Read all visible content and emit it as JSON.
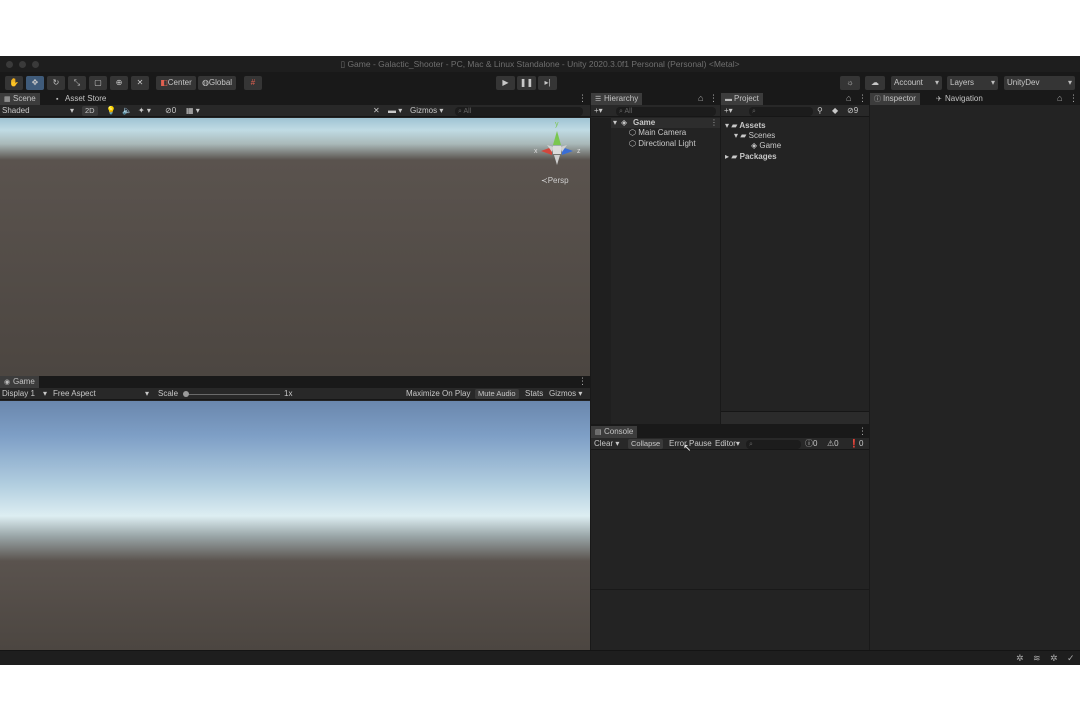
{
  "window": {
    "title": "Game - Galactic_Shooter - PC, Mac & Linux Standalone - Unity 2020.3.0f1 Personal (Personal) <Metal>"
  },
  "toolbar": {
    "pivot_label": "Center",
    "space_label": "Global",
    "account_label": "Account",
    "layers_label": "Layers",
    "layout_label": "UnityDev"
  },
  "scene": {
    "tab_label": "Scene",
    "asset_store_label": "Asset Store",
    "shading_mode": "Shaded",
    "mode_2d": "2D",
    "hidden_count": "0",
    "gizmos_label": "Gizmos",
    "search_placeholder": "All",
    "gizmo_y": "y",
    "gizmo_x": "x",
    "gizmo_z": "z",
    "persp_label": "Persp"
  },
  "game": {
    "tab_label": "Game",
    "display": "Display 1",
    "aspect": "Free Aspect",
    "scale_label": "Scale",
    "scale_value": "1x",
    "maximize_label": "Maximize On Play",
    "mute_label": "Mute Audio",
    "stats_label": "Stats",
    "gizmos_label": "Gizmos"
  },
  "hierarchy": {
    "tab_label": "Hierarchy",
    "search_placeholder": "All",
    "scene_name": "Game",
    "items": [
      "Main Camera",
      "Directional Light"
    ]
  },
  "project": {
    "tab_label": "Project",
    "hidden_count": "9",
    "assets_label": "Assets",
    "scenes_label": "Scenes",
    "scene_asset": "Game",
    "packages_label": "Packages"
  },
  "inspector": {
    "tab_label": "Inspector",
    "navigation_label": "Navigation"
  },
  "console": {
    "tab_label": "Console",
    "clear_label": "Clear",
    "collapse_label": "Collapse",
    "error_pause_label": "Error Pause",
    "editor_label": "Editor",
    "log_count": "0",
    "warning_count": "0",
    "error_count": "0"
  },
  "colors": {
    "accent": "#3f5b7a",
    "panel_bg": "#232323",
    "toolbar_bg": "#191919"
  }
}
